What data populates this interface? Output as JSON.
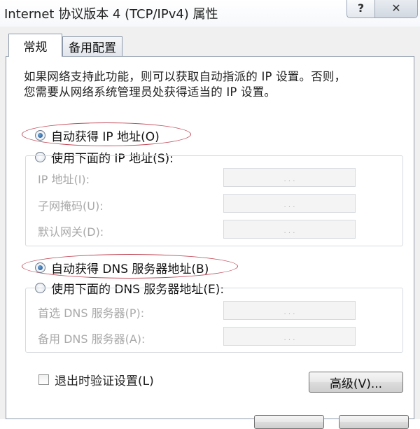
{
  "window": {
    "title": "Internet 协议版本 4 (TCP/IPv4) 属性",
    "help_glyph": "?",
    "close_glyph": "✕"
  },
  "tabs": [
    {
      "label": "常规",
      "active": true
    },
    {
      "label": "备用配置",
      "active": false
    }
  ],
  "description": {
    "line1": "如果网络支持此功能，则可以获取自动指派的 IP 设置。否则，",
    "line2": "您需要从网络系统管理员处获得适当的 IP 设置。"
  },
  "ip": {
    "auto_label": "自动获得 IP 地址(O)",
    "manual_label": "使用下面的 IP 地址(S):",
    "auto_selected": true,
    "fields": [
      {
        "label": "IP 地址(I):",
        "value": ". . ."
      },
      {
        "label": "子网掩码(U):",
        "value": ". . ."
      },
      {
        "label": "默认网关(D):",
        "value": ". . ."
      }
    ]
  },
  "dns": {
    "auto_label": "自动获得 DNS 服务器地址(B)",
    "manual_label": "使用下面的 DNS 服务器地址(E):",
    "auto_selected": true,
    "fields": [
      {
        "label": "首选 DNS 服务器(P):",
        "value": ". . ."
      },
      {
        "label": "备用 DNS 服务器(A):",
        "value": ". . ."
      }
    ]
  },
  "validate_checkbox": {
    "label": "退出时验证设置(L)",
    "checked": false
  },
  "buttons": {
    "advanced": "高级(V)..."
  },
  "colors": {
    "highlight_oval": "#c04a58",
    "frame": "#8e9aab"
  }
}
